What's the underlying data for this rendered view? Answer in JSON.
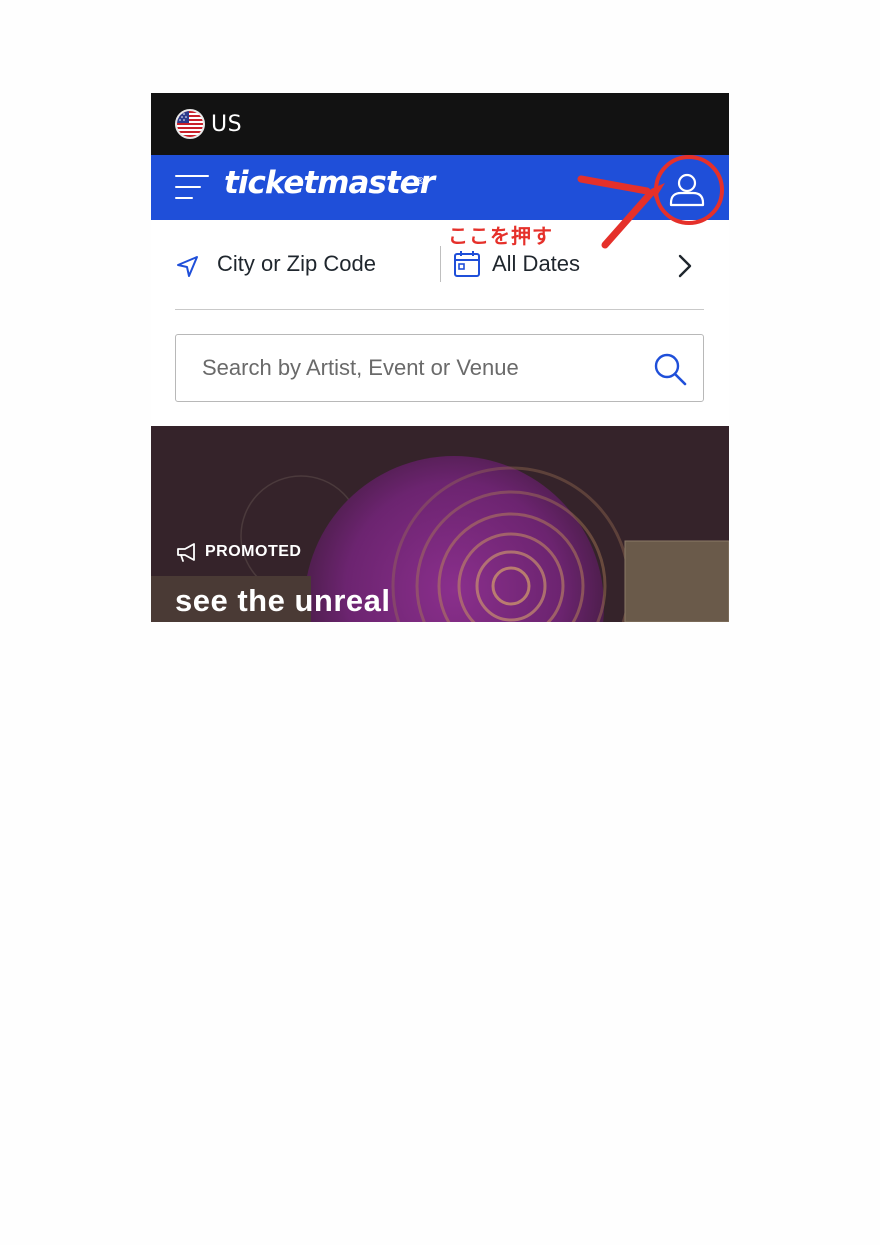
{
  "header": {
    "region_label": "US",
    "brand_name": "ticketmaster",
    "brand_mark": "®"
  },
  "annotation": {
    "text": "ここを押す",
    "color": "#e5302a"
  },
  "filters": {
    "location_label": "City or Zip Code",
    "dates_label": "All Dates"
  },
  "search": {
    "placeholder": "Search by Artist, Event or Venue",
    "value": ""
  },
  "promo": {
    "badge_label": "PROMOTED",
    "title": "see the unreal"
  },
  "icons": {
    "region": "us-flag-icon",
    "menu": "hamburger-menu-icon",
    "account": "user-account-icon",
    "location": "location-arrow-icon",
    "calendar": "calendar-icon",
    "next": "chevron-right-icon",
    "search": "search-icon",
    "promo": "megaphone-icon"
  },
  "colors": {
    "brand_blue": "#1f4fd9",
    "region_bar": "#121212",
    "accent_blue": "#1f4fd9"
  }
}
